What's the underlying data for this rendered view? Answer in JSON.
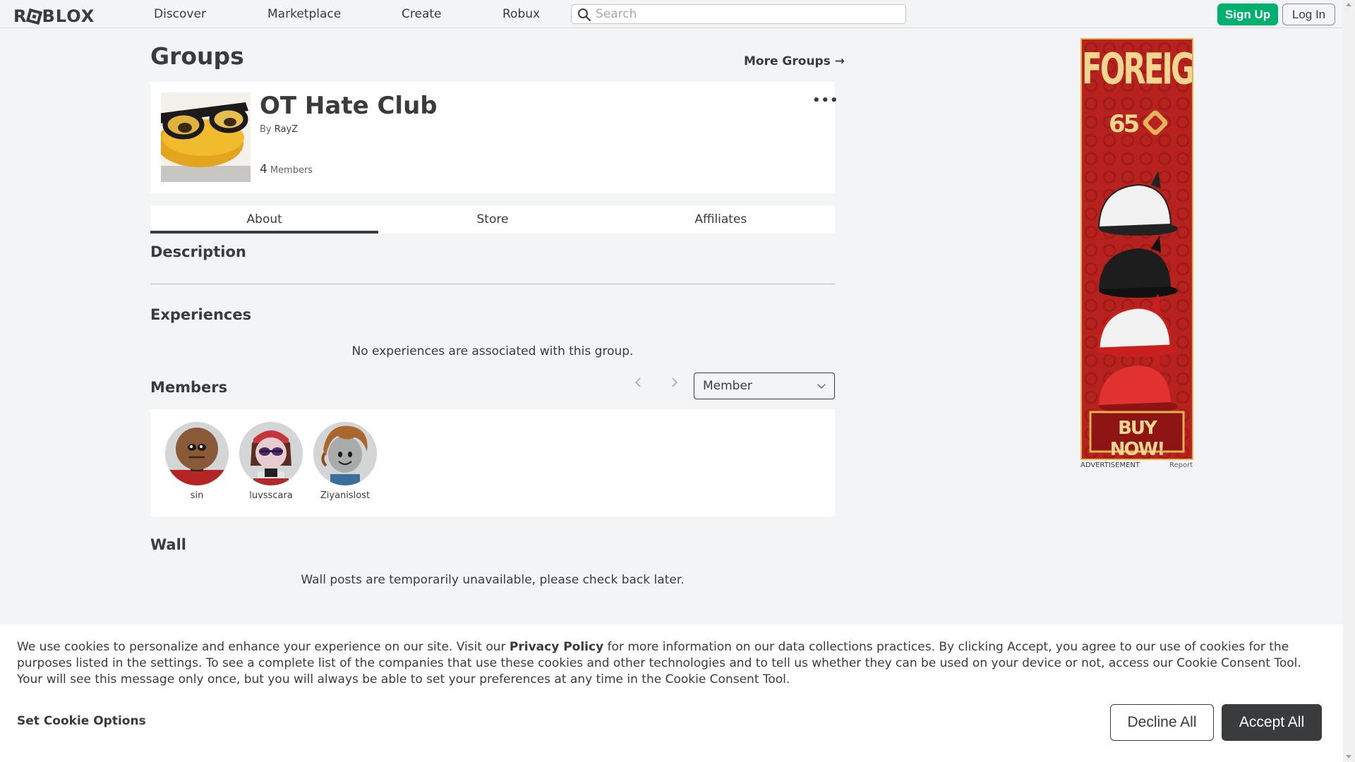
{
  "nav": {
    "logo": "ROBLOX",
    "links": [
      "Discover",
      "Marketplace",
      "Create",
      "Robux"
    ],
    "search_placeholder": "Search",
    "signup_label": "Sign Up",
    "login_label": "Log In"
  },
  "page": {
    "title": "Groups",
    "more_groups": "More Groups →"
  },
  "group": {
    "name": "OT Hate Club",
    "by_prefix": "By",
    "owner": "RayZ",
    "member_count": "4",
    "member_label": "Members",
    "more_menu": "•••"
  },
  "tabs": [
    "About",
    "Store",
    "Affiliates"
  ],
  "sections": {
    "description": "Description",
    "experiences": "Experiences",
    "experiences_empty": "No experiences are associated with this group.",
    "members": "Members",
    "role_selected": "Member",
    "wall": "Wall",
    "wall_msg": "Wall posts are temporarily unavailable, please check back later."
  },
  "members": [
    {
      "name": "sin"
    },
    {
      "name": "luvsscara"
    },
    {
      "name": "Ziyanislost"
    }
  ],
  "ad": {
    "headline": "FOREIGN",
    "price": "65",
    "cta": "BUY NOW!",
    "label": "ADVERTISEMENT",
    "report": "Report"
  },
  "cookie": {
    "text_before": "We use cookies to personalize and enhance your experience on our site. Visit our ",
    "policy_link": "Privacy Policy",
    "text_after": " for more information on our data collections practices. By clicking Accept, you agree to our use of cookies for the purposes listed in the settings. To see a complete list of the companies that use these cookies and other technologies and to tell us whether they can be used on your device or not, access our Cookie Consent Tool. Your will see this message only once, but you will always be able to set your preferences at any time in the Cookie Consent Tool.",
    "set_options": "Set Cookie Options",
    "decline": "Decline All",
    "accept": "Accept All"
  },
  "colors": {
    "accent_green": "#00b06f",
    "text_dark": "#393b3d",
    "page_bg": "#f2f4f5",
    "ad_red": "#b8221e",
    "ad_gold": "#e6b04e"
  }
}
